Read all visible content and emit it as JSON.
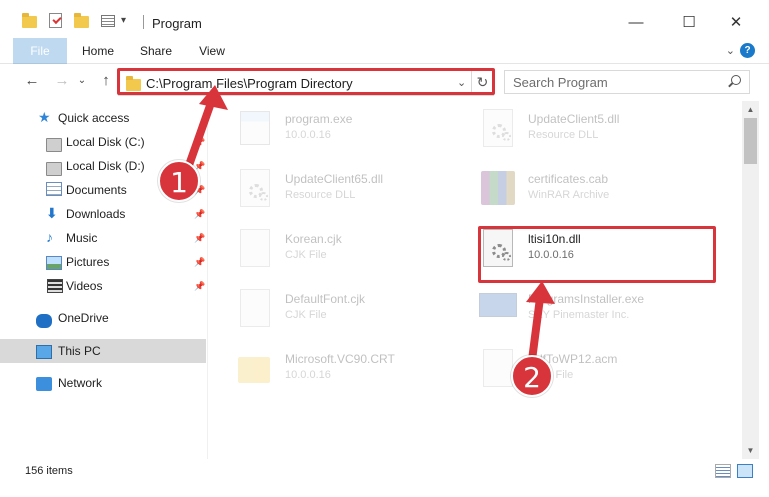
{
  "window": {
    "title": "Program",
    "minimize_glyph": "—",
    "maximize_glyph": "☐",
    "close_glyph": "✕"
  },
  "ribbon": {
    "tabs": [
      "File",
      "Home",
      "Share",
      "View"
    ],
    "expand_glyph": "⌄",
    "help_glyph": "?"
  },
  "nav": {
    "back_glyph": "←",
    "forward_glyph": "→",
    "dropdown_glyph": "⌄",
    "up_glyph": "↑",
    "address": "C:\\Program Files\\Program Directory",
    "address_dropdown_glyph": "⌄",
    "refresh_glyph": "↻",
    "search_placeholder": "Search Program"
  },
  "sidebar": {
    "items": [
      {
        "label": "Quick access",
        "icon": "star-icon",
        "pinned": false
      },
      {
        "label": "Local Disk (C:)",
        "icon": "disk-icon",
        "pinned": true
      },
      {
        "label": "Local Disk (D:)",
        "icon": "disk-icon",
        "pinned": true
      },
      {
        "label": "Documents",
        "icon": "documents-icon",
        "pinned": true
      },
      {
        "label": "Downloads",
        "icon": "downloads-icon",
        "pinned": true
      },
      {
        "label": "Music",
        "icon": "music-icon",
        "pinned": true
      },
      {
        "label": "Pictures",
        "icon": "pictures-icon",
        "pinned": true
      },
      {
        "label": "Videos",
        "icon": "videos-icon",
        "pinned": true
      },
      {
        "label": "OneDrive",
        "icon": "onedrive-icon",
        "pinned": false
      },
      {
        "label": "This PC",
        "icon": "this-pc-icon",
        "pinned": false,
        "selected": true
      },
      {
        "label": "Network",
        "icon": "network-icon",
        "pinned": false
      }
    ],
    "pin_glyph": "📌"
  },
  "files": [
    {
      "name": "program.exe",
      "desc": "10.0.0.16",
      "icon": "exe-file-icon"
    },
    {
      "name": "UpdateClient5.dll",
      "desc": "Resource DLL",
      "icon": "dll-file-icon"
    },
    {
      "name": "UpdateClient65.dll",
      "desc": "Resource DLL",
      "icon": "dll-file-icon"
    },
    {
      "name": "certificates.cab",
      "desc": "WinRAR Archive",
      "icon": "archive-file-icon"
    },
    {
      "name": "Korean.cjk",
      "desc": "CJK File",
      "icon": "generic-file-icon"
    },
    {
      "name": "ltisi10n.dll",
      "desc": "10.0.0.16",
      "icon": "dll-file-icon",
      "highlighted": true
    },
    {
      "name": "DefaultFont.cjk",
      "desc": "CJK File",
      "icon": "generic-file-icon"
    },
    {
      "name": "ProgramsInstaller.exe",
      "desc": "SEY Pinemaster Inc.",
      "icon": "installer-file-icon"
    },
    {
      "name": "Microsoft.VC90.CRT",
      "desc": "10.0.0.16",
      "icon": "folder-icon"
    },
    {
      "name": "PdfToWP12.acm",
      "desc": "ACM File",
      "icon": "generic-file-icon"
    }
  ],
  "scrollbar": {
    "up_glyph": "▲",
    "down_glyph": "▼"
  },
  "status": {
    "item_count": "156 items"
  },
  "callouts": [
    "1",
    "2"
  ],
  "colors": {
    "accent": "#1979ca",
    "highlight": "#d8343b"
  }
}
